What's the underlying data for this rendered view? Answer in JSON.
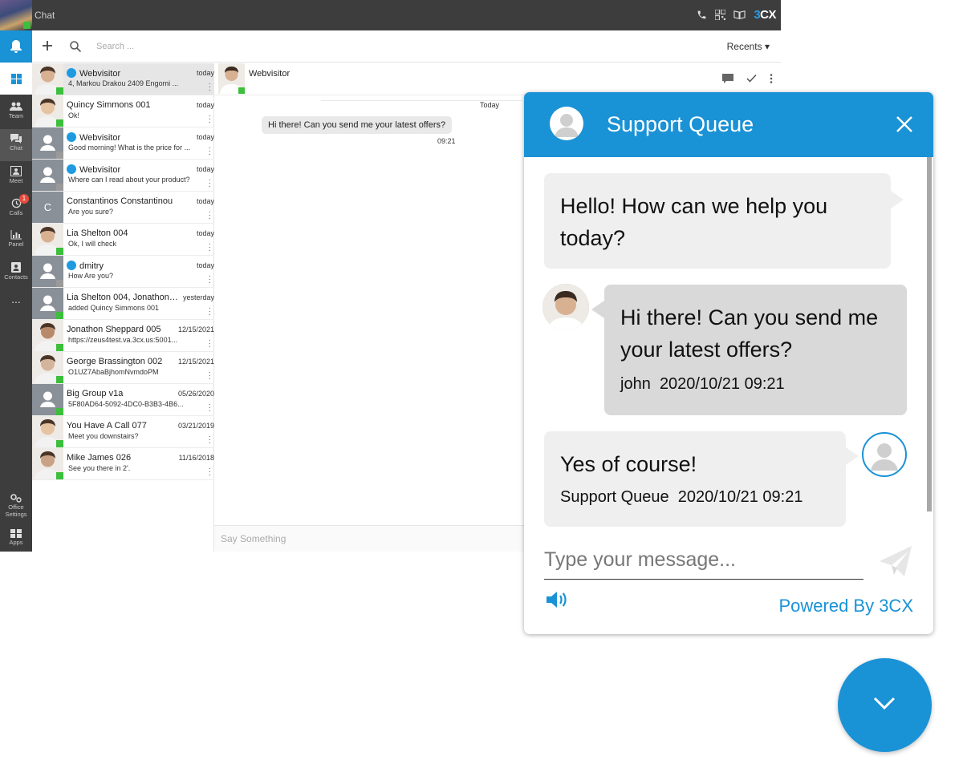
{
  "app": {
    "title": "Chat",
    "brand_main": "3",
    "brand_accent": "CX"
  },
  "rail": {
    "items": [
      {
        "label": "Team"
      },
      {
        "label": "Chat"
      },
      {
        "label": "Meet"
      },
      {
        "label": "Calls",
        "badge": "1"
      },
      {
        "label": "Panel"
      },
      {
        "label": "Contacts"
      },
      {
        "label": "..."
      }
    ],
    "bottom": [
      {
        "label": "Office Settings"
      },
      {
        "label": "Apps"
      }
    ]
  },
  "header": {
    "search_placeholder": "Search ...",
    "recents_label": "Recents ▾"
  },
  "conversations": [
    {
      "name": "Webvisitor",
      "date": "today",
      "preview": "4, Markou Drakou 2409 Engomi ...",
      "webvisitor": true,
      "selected": true
    },
    {
      "name": "Quincy Simmons 001",
      "date": "today",
      "preview": "Ok!"
    },
    {
      "name": "Webvisitor",
      "date": "today",
      "preview": "Good morning! What is the price for ...",
      "webvisitor": true
    },
    {
      "name": "Webvisitor",
      "date": "today",
      "preview": "Where can I read about your product?",
      "webvisitor": true
    },
    {
      "name": "Constantinos Constantinou",
      "date": "today",
      "preview": "Are you sure?",
      "letter": "C"
    },
    {
      "name": "Lia Shelton 004",
      "date": "today",
      "preview": "Ok, I will check"
    },
    {
      "name": "dmitry",
      "date": "today",
      "preview": "How Are you?",
      "webvisitor": true
    },
    {
      "name": "Lia Shelton 004, Jonathon ...",
      "date": "yesterday",
      "preview": "added Quincy Simmons 001"
    },
    {
      "name": "Jonathon Sheppard 005",
      "date": "12/15/2021",
      "preview": "https://zeus4test.va.3cx.us:5001..."
    },
    {
      "name": "George Brassington 002",
      "date": "12/15/2021",
      "preview": "O1UZ7AbaBjhomNvmdoPM"
    },
    {
      "name": "Big Group v1a",
      "date": "05/26/2020",
      "preview": "5F80AD64-5092-4DC0-B3B3-4B6..."
    },
    {
      "name": "You Have A Call 077",
      "date": "03/21/2019",
      "preview": "Meet you downstairs?"
    },
    {
      "name": "Mike James 026",
      "date": "11/16/2018",
      "preview": "See you there in 2'."
    }
  ],
  "chat": {
    "contact_name": "Webvisitor",
    "day_label": "Today",
    "message": "Hi there! Can you send me your latest offers?",
    "message_time": "09:21",
    "composer_placeholder": "Say Something"
  },
  "widget": {
    "title": "Support Queue",
    "messages": [
      {
        "text": "Hello! How can we help you today?"
      },
      {
        "text": "Hi there! Can you send me your latest offers?",
        "author": "john",
        "time": "2020/10/21 09:21"
      },
      {
        "text": "Yes of course!",
        "author": "Support Queue",
        "time": "2020/10/21 09:21"
      }
    ],
    "input_placeholder": "Type your message...",
    "powered_by": "Powered By 3CX"
  },
  "colors": {
    "accent": "#1a92d6",
    "dark": "#3d3d3d",
    "online": "#3cbf3c"
  }
}
